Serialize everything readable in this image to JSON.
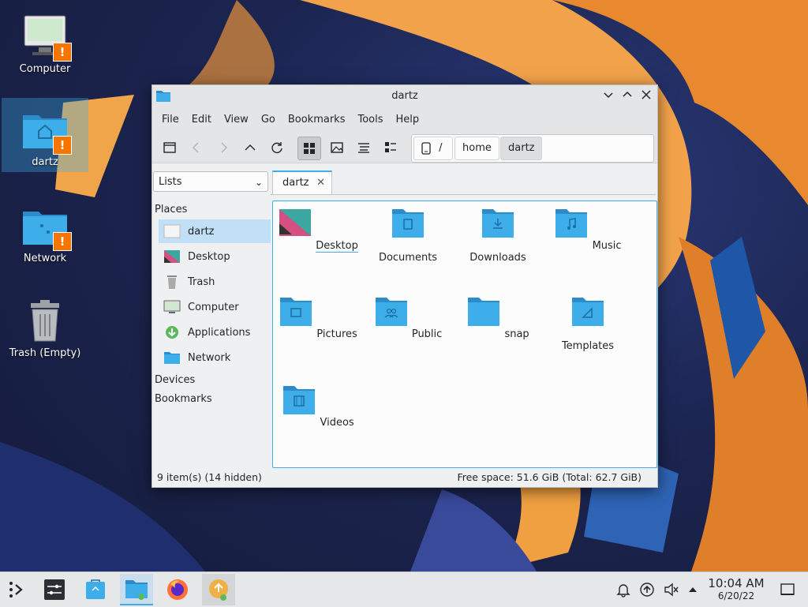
{
  "desktop": {
    "icons": [
      {
        "label": "Computer"
      },
      {
        "label": "dartz"
      },
      {
        "label": "Network"
      },
      {
        "label": "Trash (Empty)"
      }
    ]
  },
  "window": {
    "title": "dartz",
    "menu": [
      "File",
      "Edit",
      "View",
      "Go",
      "Bookmarks",
      "Tools",
      "Help"
    ],
    "breadcrumb": {
      "root": "/",
      "items": [
        "home",
        "dartz"
      ]
    },
    "panel_combo": "Lists",
    "tab_label": "dartz",
    "places": {
      "heading": "Places",
      "items": [
        "dartz",
        "Desktop",
        "Trash",
        "Computer",
        "Applications",
        "Network"
      ],
      "selected": "dartz"
    },
    "devices_heading": "Devices",
    "bookmarks_heading": "Bookmarks",
    "files": [
      "Desktop",
      "Documents",
      "Downloads",
      "Music",
      "Pictures",
      "Public",
      "snap",
      "Templates",
      "Videos"
    ],
    "status_left": "9 item(s) (14 hidden)",
    "status_right": "Free space: 51.6 GiB (Total: 62.7 GiB)"
  },
  "taskbar": {
    "time": "10:04 AM",
    "date": "6/20/22"
  },
  "colors": {
    "accent": "#3daee9",
    "folder": "#3daee9",
    "warning": "#f67400"
  }
}
